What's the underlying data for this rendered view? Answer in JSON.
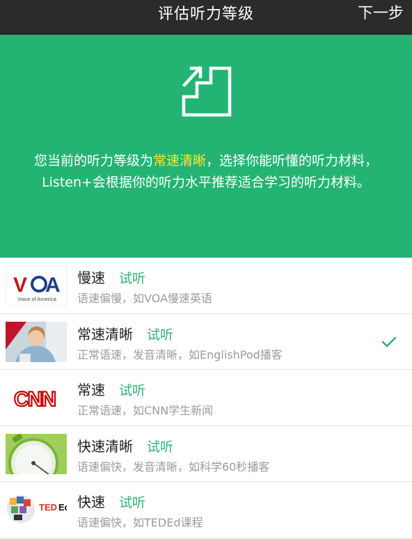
{
  "nav": {
    "title": "评估听力等级",
    "next": "下一步"
  },
  "hero": {
    "icon": "stairs-arrow-icon",
    "text_before": "您当前的听力等级为",
    "level": "常速清晰",
    "text_after": "，选择你能听懂的听力材料，Listen+会根据你的听力水平推荐适合学习的听力材料。"
  },
  "colors": {
    "accent": "#23b474",
    "highlight": "#ffe82e",
    "navbar": "#2b2b2b",
    "link": "#2ab374"
  },
  "levels": [
    {
      "title": "慢速",
      "try": "试听",
      "desc": "语速偏慢，如VOA慢速英语",
      "thumb": "voa-logo",
      "thumb_caption": "Voice of America"
    },
    {
      "title": "常速清晰",
      "try": "试听",
      "desc": "正常语速，发音清晰，如EnglishPod播客",
      "thumb": "woman-photo",
      "selected": true,
      "check_icon": "checkmark-icon"
    },
    {
      "title": "常速",
      "try": "试听",
      "desc": "正常语速，如CNN学生新闻",
      "thumb": "cnn-logo"
    },
    {
      "title": "快速清晰",
      "try": "试听",
      "desc": "语速偏快，发音清晰，如科学60秒播客",
      "thumb": "stopwatch-image"
    },
    {
      "title": "快速",
      "try": "试听",
      "desc": "语速偏快，如TEDEd课程",
      "thumb": "ted-ed-logo"
    }
  ]
}
